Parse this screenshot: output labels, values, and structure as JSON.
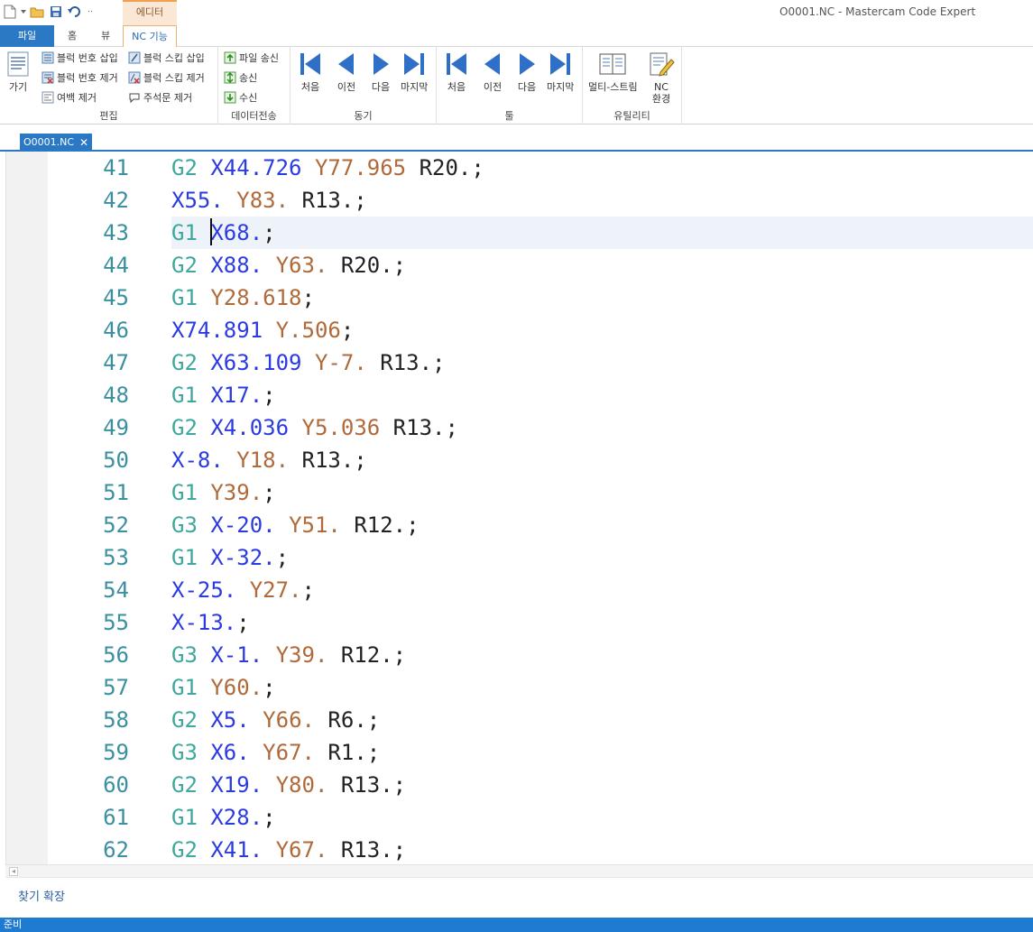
{
  "window": {
    "title": "O0001.NC - Mastercam Code Expert",
    "context_tab": "에디터"
  },
  "tabs": {
    "file": "파일",
    "home": "홈",
    "view": "뷰",
    "nc": "NC 기능"
  },
  "ribbon": {
    "edit": {
      "goto": "가기",
      "insert_block_numbers": "블럭 번호 삽입",
      "remove_block_numbers": "블럭 번호 제거",
      "remove_spaces": "여백 제거",
      "insert_block_skip": "블럭 스킵 삽입",
      "remove_block_skip": "블럭 스킵 제거",
      "remove_comments": "주석문 제거",
      "label": "편집"
    },
    "data_transfer": {
      "send_file": "파일 송신",
      "send": "송신",
      "receive": "수신",
      "label": "데이터전송"
    },
    "sync": {
      "first": "처음",
      "prev": "이전",
      "next": "다음",
      "last": "마지막",
      "label": "동기"
    },
    "tool": {
      "first": "처음",
      "prev": "이전",
      "next": "다음",
      "last": "마지막",
      "label": "툴"
    },
    "utility": {
      "multistream": "멀티-스트림",
      "nc_env_1": "NC",
      "nc_env_2": "환경",
      "label": "유틸리티"
    }
  },
  "document": {
    "tab_name": "O0001.NC",
    "close": "✕"
  },
  "editor": {
    "current_line": 43,
    "lines": [
      {
        "n": "41",
        "tokens": [
          [
            "g",
            "G2"
          ],
          [
            "x",
            "X44.726"
          ],
          [
            "y",
            "Y77.965"
          ],
          [
            "r",
            "R20."
          ],
          [
            "p",
            ";"
          ]
        ]
      },
      {
        "n": "42",
        "tokens": [
          [
            "x",
            "X55."
          ],
          [
            "y",
            "Y83."
          ],
          [
            "r",
            "R13."
          ],
          [
            "p",
            ";"
          ]
        ]
      },
      {
        "n": "43",
        "tokens": [
          [
            "g",
            "G1"
          ],
          [
            "x",
            "X68."
          ],
          [
            "p",
            ";"
          ]
        ]
      },
      {
        "n": "44",
        "tokens": [
          [
            "g",
            "G2"
          ],
          [
            "x",
            "X88."
          ],
          [
            "y",
            "Y63."
          ],
          [
            "r",
            "R20."
          ],
          [
            "p",
            ";"
          ]
        ]
      },
      {
        "n": "45",
        "tokens": [
          [
            "g",
            "G1"
          ],
          [
            "y",
            "Y28.618"
          ],
          [
            "p",
            ";"
          ]
        ]
      },
      {
        "n": "46",
        "tokens": [
          [
            "x",
            "X74.891"
          ],
          [
            "y",
            "Y.506"
          ],
          [
            "p",
            ";"
          ]
        ]
      },
      {
        "n": "47",
        "tokens": [
          [
            "g",
            "G2"
          ],
          [
            "x",
            "X63.109"
          ],
          [
            "y",
            "Y-7."
          ],
          [
            "r",
            "R13."
          ],
          [
            "p",
            ";"
          ]
        ]
      },
      {
        "n": "48",
        "tokens": [
          [
            "g",
            "G1"
          ],
          [
            "x",
            "X17."
          ],
          [
            "p",
            ";"
          ]
        ]
      },
      {
        "n": "49",
        "tokens": [
          [
            "g",
            "G2"
          ],
          [
            "x",
            "X4.036"
          ],
          [
            "y",
            "Y5.036"
          ],
          [
            "r",
            "R13."
          ],
          [
            "p",
            ";"
          ]
        ]
      },
      {
        "n": "50",
        "tokens": [
          [
            "x",
            "X-8."
          ],
          [
            "y",
            "Y18."
          ],
          [
            "r",
            "R13."
          ],
          [
            "p",
            ";"
          ]
        ]
      },
      {
        "n": "51",
        "tokens": [
          [
            "g",
            "G1"
          ],
          [
            "y",
            "Y39."
          ],
          [
            "p",
            ";"
          ]
        ]
      },
      {
        "n": "52",
        "tokens": [
          [
            "g",
            "G3"
          ],
          [
            "x",
            "X-20."
          ],
          [
            "y",
            "Y51."
          ],
          [
            "r",
            "R12."
          ],
          [
            "p",
            ";"
          ]
        ]
      },
      {
        "n": "53",
        "tokens": [
          [
            "g",
            "G1"
          ],
          [
            "x",
            "X-32."
          ],
          [
            "p",
            ";"
          ]
        ]
      },
      {
        "n": "54",
        "tokens": [
          [
            "x",
            "X-25."
          ],
          [
            "y",
            "Y27."
          ],
          [
            "p",
            ";"
          ]
        ]
      },
      {
        "n": "55",
        "tokens": [
          [
            "x",
            "X-13."
          ],
          [
            "p",
            ";"
          ]
        ]
      },
      {
        "n": "56",
        "tokens": [
          [
            "g",
            "G3"
          ],
          [
            "x",
            "X-1."
          ],
          [
            "y",
            "Y39."
          ],
          [
            "r",
            "R12."
          ],
          [
            "p",
            ";"
          ]
        ]
      },
      {
        "n": "57",
        "tokens": [
          [
            "g",
            "G1"
          ],
          [
            "y",
            "Y60."
          ],
          [
            "p",
            ";"
          ]
        ]
      },
      {
        "n": "58",
        "tokens": [
          [
            "g",
            "G2"
          ],
          [
            "x",
            "X5."
          ],
          [
            "y",
            "Y66."
          ],
          [
            "r",
            "R6."
          ],
          [
            "p",
            ";"
          ]
        ]
      },
      {
        "n": "59",
        "tokens": [
          [
            "g",
            "G3"
          ],
          [
            "x",
            "X6."
          ],
          [
            "y",
            "Y67."
          ],
          [
            "r",
            "R1."
          ],
          [
            "p",
            ";"
          ]
        ]
      },
      {
        "n": "60",
        "tokens": [
          [
            "g",
            "G2"
          ],
          [
            "x",
            "X19."
          ],
          [
            "y",
            "Y80."
          ],
          [
            "r",
            "R13."
          ],
          [
            "p",
            ";"
          ]
        ]
      },
      {
        "n": "61",
        "tokens": [
          [
            "g",
            "G1"
          ],
          [
            "x",
            "X28."
          ],
          [
            "p",
            ";"
          ]
        ]
      },
      {
        "n": "62",
        "tokens": [
          [
            "g",
            "G2"
          ],
          [
            "x",
            "X41."
          ],
          [
            "y",
            "Y67."
          ],
          [
            "r",
            "R13."
          ],
          [
            "p",
            ";"
          ]
        ]
      }
    ]
  },
  "findbar": {
    "expand": "찾기 확장"
  },
  "status": {
    "text": "준비"
  },
  "colors": {
    "accent": "#2b78c5",
    "gcode": "#3ea89c",
    "xaxis": "#2c3be0",
    "yaxis": "#b06a3a"
  }
}
